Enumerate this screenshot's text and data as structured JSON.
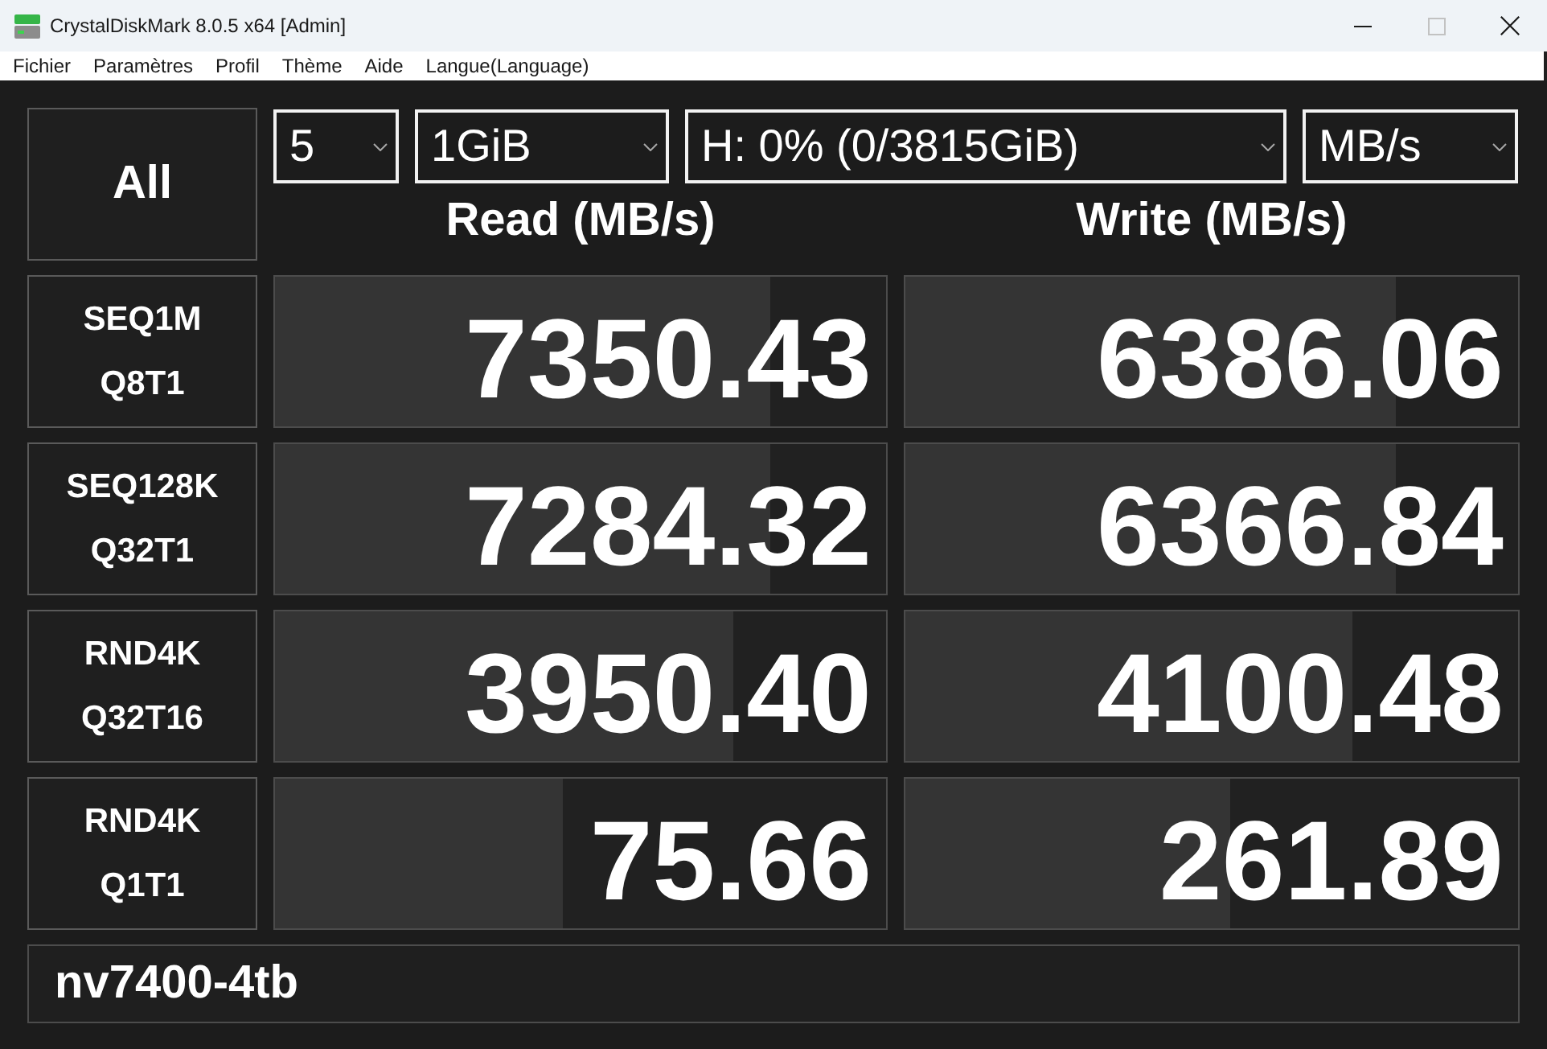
{
  "window": {
    "title": "CrystalDiskMark 8.0.5 x64 [Admin]",
    "controls": [
      {
        "kind": "minimize",
        "disabled": false
      },
      {
        "kind": "maximize",
        "disabled": true
      },
      {
        "kind": "close",
        "disabled": false
      }
    ]
  },
  "menu": [
    "Fichier",
    "Paramètres",
    "Profil",
    "Thème",
    "Aide",
    "Langue(Language)"
  ],
  "all_button": "All",
  "settings": [
    "5",
    "1GiB",
    "H: 0% (0/3815GiB)",
    "MB/s"
  ],
  "columns": [
    "Read (MB/s)",
    "Write (MB/s)"
  ],
  "tests": [
    {
      "label": [
        "SEQ1M",
        "Q8T1"
      ],
      "read": {
        "value": "7350.43",
        "level": 0.81
      },
      "write": {
        "value": "6386.06",
        "level": 0.8
      }
    },
    {
      "label": [
        "SEQ128K",
        "Q32T1"
      ],
      "read": {
        "value": "7284.32",
        "level": 0.81
      },
      "write": {
        "value": "6366.84",
        "level": 0.8
      }
    },
    {
      "label": [
        "RND4K",
        "Q32T16"
      ],
      "read": {
        "value": "3950.40",
        "level": 0.75
      },
      "write": {
        "value": "4100.48",
        "level": 0.73
      }
    },
    {
      "label": [
        "RND4K",
        "Q1T1"
      ],
      "read": {
        "value": "75.66",
        "level": 0.47
      },
      "write": {
        "value": "261.89",
        "level": 0.53
      }
    }
  ],
  "comment": "nv7400-4tb"
}
